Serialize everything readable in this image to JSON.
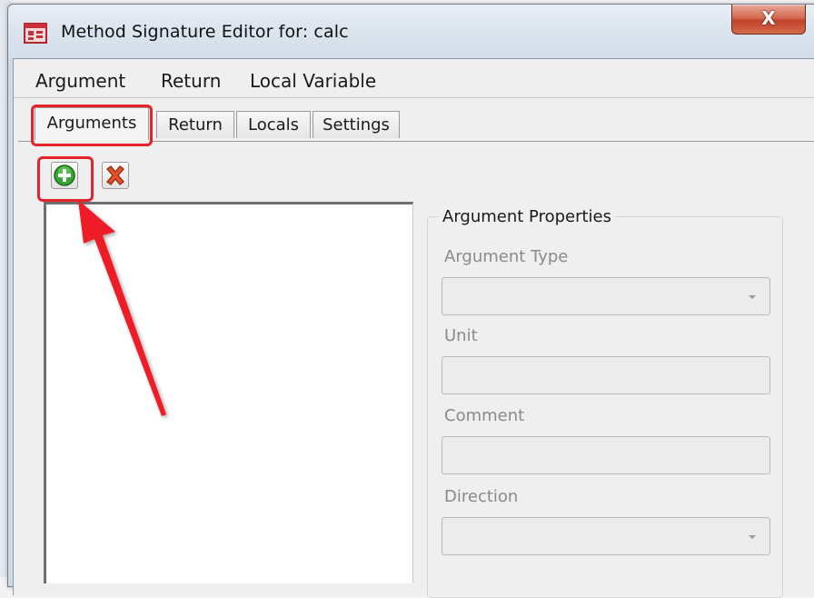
{
  "window": {
    "title": "Method Signature Editor for: calc",
    "close_symbol": "X"
  },
  "menu": [
    "Argument",
    "Return",
    "Local Variable"
  ],
  "tabs": [
    "Arguments",
    "Return",
    "Locals",
    "Settings"
  ],
  "active_tab": "Arguments",
  "toolbar": {
    "add_icon": "add-icon",
    "remove_icon": "remove-icon"
  },
  "argument_properties": {
    "group_title": "Argument Properties",
    "argument_type_label": "Argument Type",
    "argument_type_value": "",
    "unit_label": "Unit",
    "unit_value": "",
    "comment_label": "Comment",
    "comment_value": "",
    "direction_label": "Direction",
    "direction_value": ""
  },
  "annotation": {
    "color": "#e5232b"
  },
  "colors": {
    "titlebar": "#dce5ee",
    "close_button": "#c1432a",
    "dialog_bg": "#efefef",
    "disabled_field": "#ececec"
  }
}
